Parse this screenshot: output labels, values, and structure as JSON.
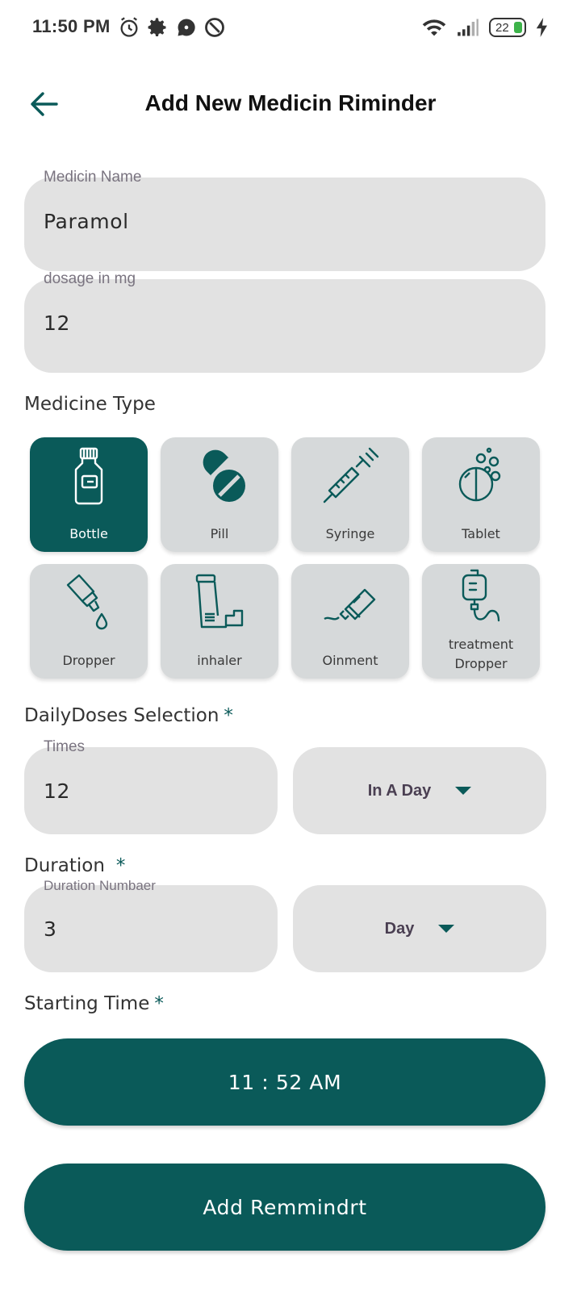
{
  "status_bar": {
    "time": "11:50 PM",
    "battery": "22"
  },
  "header": {
    "title": "Add New Medicin Riminder"
  },
  "medicine_name": {
    "label": "Medicin Name",
    "value": "Paramol"
  },
  "dosage": {
    "label": "dosage in mg",
    "value": "12"
  },
  "medicine_type": {
    "title": "Medicine Type",
    "selected": "Bottle",
    "items": [
      {
        "label": "Bottle",
        "icon": "bottle-icon"
      },
      {
        "label": "Pill",
        "icon": "pill-icon"
      },
      {
        "label": "Syringe",
        "icon": "syringe-icon"
      },
      {
        "label": "Tablet",
        "icon": "tablet-icon"
      },
      {
        "label": "Dropper",
        "icon": "dropper-icon"
      },
      {
        "label": "inhaler",
        "icon": "inhaler-icon"
      },
      {
        "label": "Oinment",
        "icon": "ointment-icon"
      },
      {
        "label": "treatment\nDropper",
        "label_line1": "treatment",
        "label_line2": "Dropper",
        "icon": "iv-bag-icon"
      }
    ]
  },
  "daily_doses": {
    "title": "DailyDoses Selection",
    "required_mark": "*",
    "times_label": "Times",
    "times_value": "12",
    "period": "In A Day"
  },
  "duration": {
    "title": "Duration",
    "required_mark": "*",
    "number_label": "Duration Numbaer",
    "number_value": "3",
    "unit": "Day"
  },
  "starting_time": {
    "title": "Starting Time",
    "required_mark": "*",
    "value": "11 : 52 AM"
  },
  "submit": {
    "label": "Add Remmindrt"
  },
  "colors": {
    "primary": "#0a5a59",
    "field_bg": "#e2e2e2",
    "tile_bg": "#d6d9da"
  }
}
